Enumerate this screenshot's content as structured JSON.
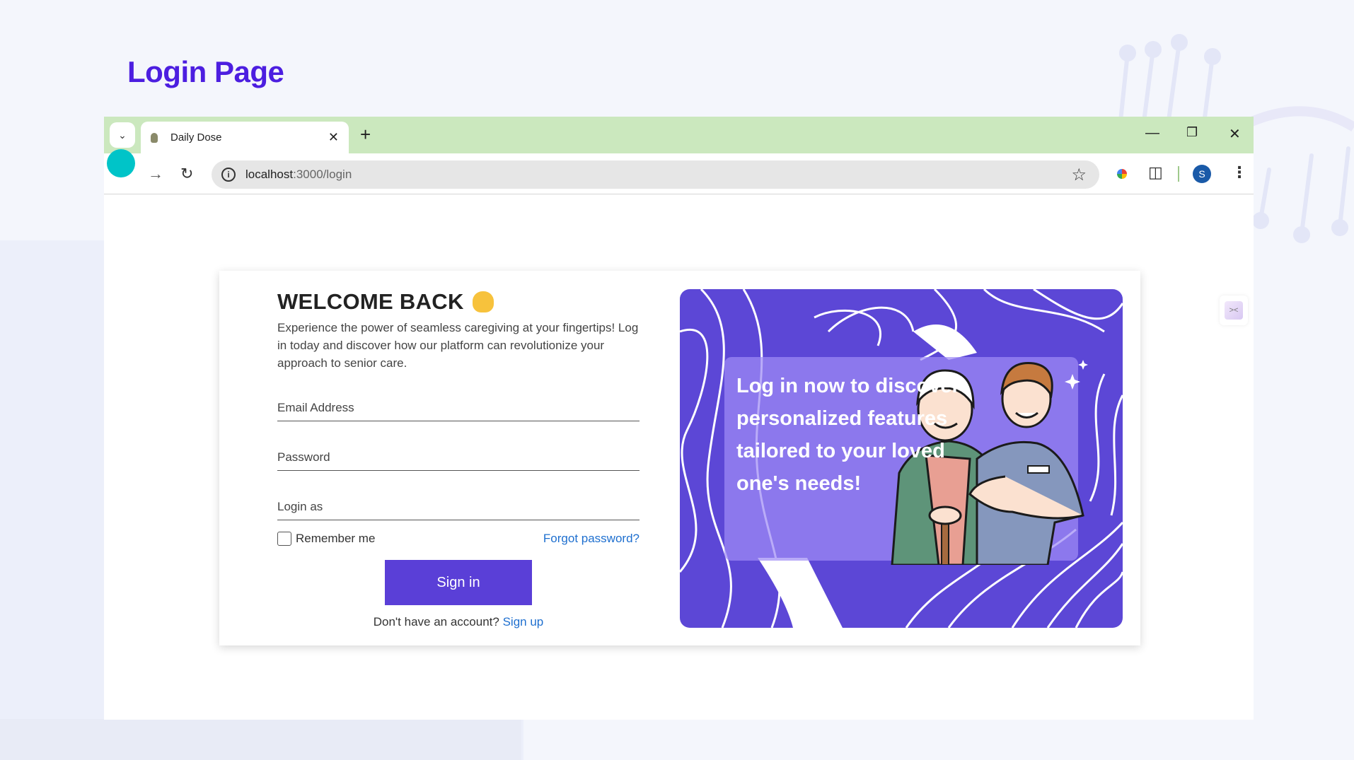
{
  "slide": {
    "title": "Login Page"
  },
  "browser": {
    "tab_title": "Daily Dose",
    "url_host": "localhost",
    "url_path": ":3000/login",
    "profile_initial": "S"
  },
  "login": {
    "heading": "WELCOME BACK",
    "intro": "Experience the power of seamless caregiving at your fingertips! Log in today and discover how our platform can revolutionize your approach to senior care.",
    "email_label": "Email Address",
    "password_label": "Password",
    "role_label": "Login as",
    "remember_label": "Remember me",
    "forgot_label": "Forgot password?",
    "signin_label": "Sign in",
    "signup_prompt": "Don't have an account?",
    "signup_link": "Sign up"
  },
  "promo": {
    "text": "Log in now to discover personalized features tailored to your loved one's needs!"
  },
  "colors": {
    "accent": "#5a3fd7",
    "title": "#4c1ee0",
    "tabbar": "#cbe8be",
    "link": "#1e6fcf"
  }
}
